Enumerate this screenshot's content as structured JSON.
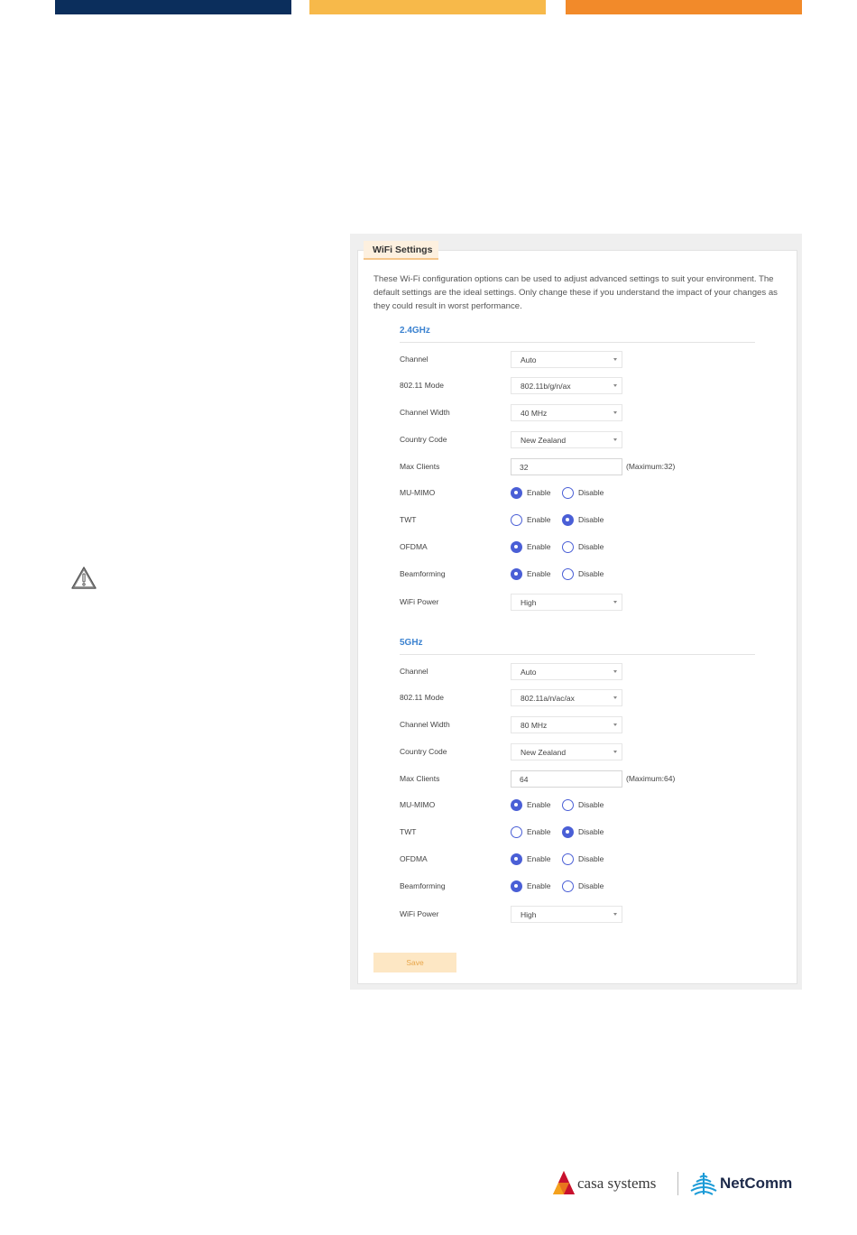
{
  "colors": {
    "navy": "#0b2e5c",
    "gold": "#f7b94a",
    "orange": "#f28a2a",
    "accent": "#3b82d0",
    "radio": "#4a5fd6"
  },
  "card": {
    "tab_label": "WiFi Settings",
    "intro": "These Wi-Fi configuration options can be used to adjust advanced settings to suit your environment. The default settings are the ideal settings. Only change these if you understand the impact of your changes as they could result in worst performance."
  },
  "labels": {
    "channel": "Channel",
    "mode": "802.11 Mode",
    "width": "Channel Width",
    "country": "Country Code",
    "max_clients": "Max Clients",
    "mumimo": "MU-MIMO",
    "twt": "TWT",
    "ofdma": "OFDMA",
    "beamforming": "Beamforming",
    "power": "WiFi Power",
    "enable": "Enable",
    "disable": "Disable"
  },
  "band24": {
    "title": "2.4GHz",
    "channel": "Auto",
    "mode": "802.11b/g/n/ax",
    "width": "40 MHz",
    "country": "New Zealand",
    "max_clients": "32",
    "max_hint": "(Maximum:32)",
    "mumimo": "Enable",
    "twt": "Disable",
    "ofdma": "Enable",
    "beamforming": "Enable",
    "power": "High"
  },
  "band5": {
    "title": "5GHz",
    "channel": "Auto",
    "mode": "802.11a/n/ac/ax",
    "width": "80 MHz",
    "country": "New Zealand",
    "max_clients": "64",
    "max_hint": "(Maximum:64)",
    "mumimo": "Enable",
    "twt": "Disable",
    "ofdma": "Enable",
    "beamforming": "Enable",
    "power": "High"
  },
  "save_label": "Save",
  "logos": {
    "casa": "casa systems",
    "netcomm": "NetComm"
  },
  "icons": {
    "warning": "warning-icon",
    "casa": "casa-logo-icon",
    "netcomm": "netcomm-logo-icon"
  }
}
